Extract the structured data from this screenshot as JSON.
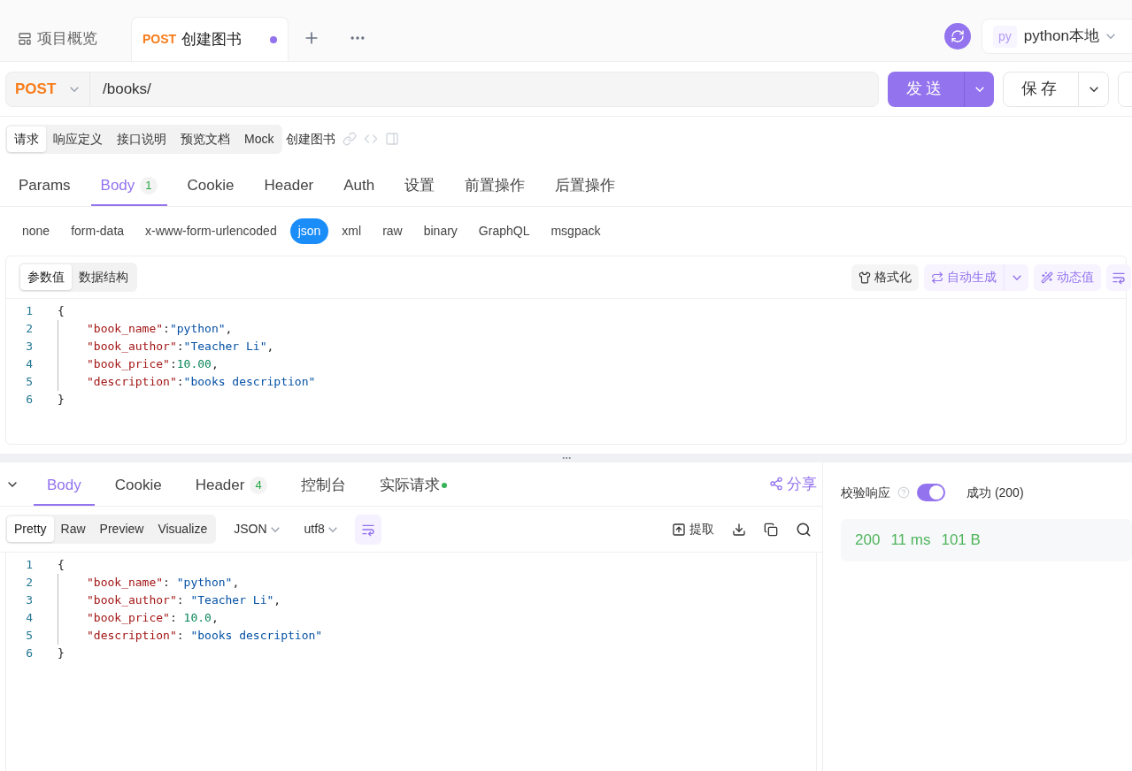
{
  "top_tabs": [
    {
      "label": "项目概览",
      "selected": false,
      "modified": false
    },
    {
      "method": "POST",
      "label": "创建图书",
      "selected": true,
      "modified": true
    }
  ],
  "environment": {
    "badge": "py",
    "label": "python本地"
  },
  "request": {
    "method": "POST",
    "url": "/books/",
    "send": "发送",
    "save": "保存"
  },
  "view_tabs": [
    {
      "label": "请求",
      "selected": true
    },
    {
      "label": "响应定义",
      "selected": false
    },
    {
      "label": "接口说明",
      "selected": false
    },
    {
      "label": "预览文档",
      "selected": false
    },
    {
      "label": "Mock",
      "selected": false
    }
  ],
  "endpoint_name": "创建图书",
  "param_tabs": [
    {
      "label": "Params",
      "selected": false
    },
    {
      "label": "Body",
      "badge": "1",
      "selected": true
    },
    {
      "label": "Cookie",
      "selected": false
    },
    {
      "label": "Header",
      "selected": false
    },
    {
      "label": "Auth",
      "selected": false
    },
    {
      "label": "设置",
      "selected": false
    },
    {
      "label": "前置操作",
      "selected": false
    },
    {
      "label": "后置操作",
      "selected": false
    }
  ],
  "body_types": [
    {
      "label": "none",
      "selected": false
    },
    {
      "label": "form-data",
      "selected": false
    },
    {
      "label": "x-www-form-urlencoded",
      "selected": false
    },
    {
      "label": "json",
      "selected": true
    },
    {
      "label": "xml",
      "selected": false
    },
    {
      "label": "raw",
      "selected": false
    },
    {
      "label": "binary",
      "selected": false
    },
    {
      "label": "GraphQL",
      "selected": false
    },
    {
      "label": "msgpack",
      "selected": false
    }
  ],
  "editor_modes": [
    {
      "label": "参数值",
      "selected": true
    },
    {
      "label": "数据结构",
      "selected": false
    }
  ],
  "editor_actions": {
    "format": "格式化",
    "auto_generate": "自动生成",
    "dynamic": "动态值"
  },
  "request_code": [
    {
      "number": "1",
      "indented": false,
      "tokens": [
        {
          "kind": "punct",
          "text": "{"
        }
      ]
    },
    {
      "number": "2",
      "indented": true,
      "tokens": [
        {
          "kind": "key",
          "text": "\"book_name\""
        },
        {
          "kind": "punct",
          "text": ":"
        },
        {
          "kind": "string",
          "text": "\"python\""
        },
        {
          "kind": "punct",
          "text": ","
        }
      ]
    },
    {
      "number": "3",
      "indented": true,
      "tokens": [
        {
          "kind": "key",
          "text": "\"book_author\""
        },
        {
          "kind": "punct",
          "text": ":"
        },
        {
          "kind": "string",
          "text": "\"Teacher Li\""
        },
        {
          "kind": "punct",
          "text": ","
        }
      ]
    },
    {
      "number": "4",
      "indented": true,
      "tokens": [
        {
          "kind": "key",
          "text": "\"book_price\""
        },
        {
          "kind": "punct",
          "text": ":"
        },
        {
          "kind": "number",
          "text": "10.00"
        },
        {
          "kind": "punct",
          "text": ","
        }
      ]
    },
    {
      "number": "5",
      "indented": true,
      "tokens": [
        {
          "kind": "key",
          "text": "\"description\""
        },
        {
          "kind": "punct",
          "text": ":"
        },
        {
          "kind": "string",
          "text": "\"books description\""
        }
      ]
    },
    {
      "number": "6",
      "indented": false,
      "tokens": [
        {
          "kind": "punct",
          "text": "}"
        }
      ]
    }
  ],
  "response_tabs": [
    {
      "label": "Body",
      "selected": true
    },
    {
      "label": "Cookie",
      "selected": false
    },
    {
      "label": "Header",
      "badge": "4",
      "selected": false
    },
    {
      "label": "控制台",
      "selected": false
    },
    {
      "label": "实际请求",
      "dot": true,
      "selected": false
    }
  ],
  "share": "分享",
  "response_modes": [
    {
      "label": "Pretty",
      "selected": true
    },
    {
      "label": "Raw",
      "selected": false
    },
    {
      "label": "Preview",
      "selected": false
    },
    {
      "label": "Visualize",
      "selected": false
    }
  ],
  "format_select": "JSON",
  "encoding_select": "utf8",
  "wrap_on": true,
  "extract": "提取",
  "response_code": [
    {
      "number": "1",
      "indented": false,
      "tokens": [
        {
          "kind": "punct",
          "text": "{"
        }
      ]
    },
    {
      "number": "2",
      "indented": true,
      "tokens": [
        {
          "kind": "key",
          "text": "\"book_name\""
        },
        {
          "kind": "punct",
          "text": ": "
        },
        {
          "kind": "string",
          "text": "\"python\""
        },
        {
          "kind": "punct",
          "text": ","
        }
      ]
    },
    {
      "number": "3",
      "indented": true,
      "tokens": [
        {
          "kind": "key",
          "text": "\"book_author\""
        },
        {
          "kind": "punct",
          "text": ": "
        },
        {
          "kind": "string",
          "text": "\"Teacher Li\""
        },
        {
          "kind": "punct",
          "text": ","
        }
      ]
    },
    {
      "number": "4",
      "indented": true,
      "tokens": [
        {
          "kind": "key",
          "text": "\"book_price\""
        },
        {
          "kind": "punct",
          "text": ": "
        },
        {
          "kind": "number",
          "text": "10.0"
        },
        {
          "kind": "punct",
          "text": ","
        }
      ]
    },
    {
      "number": "5",
      "indented": true,
      "tokens": [
        {
          "kind": "key",
          "text": "\"description\""
        },
        {
          "kind": "punct",
          "text": ": "
        },
        {
          "kind": "string",
          "text": "\"books description\""
        }
      ]
    },
    {
      "number": "6",
      "indented": false,
      "tokens": [
        {
          "kind": "punct",
          "text": "}"
        }
      ]
    }
  ],
  "validation": {
    "label": "校验响应",
    "on": true,
    "result": "成功 (200)"
  },
  "stats": [
    "200",
    "11 ms",
    "101 B"
  ]
}
